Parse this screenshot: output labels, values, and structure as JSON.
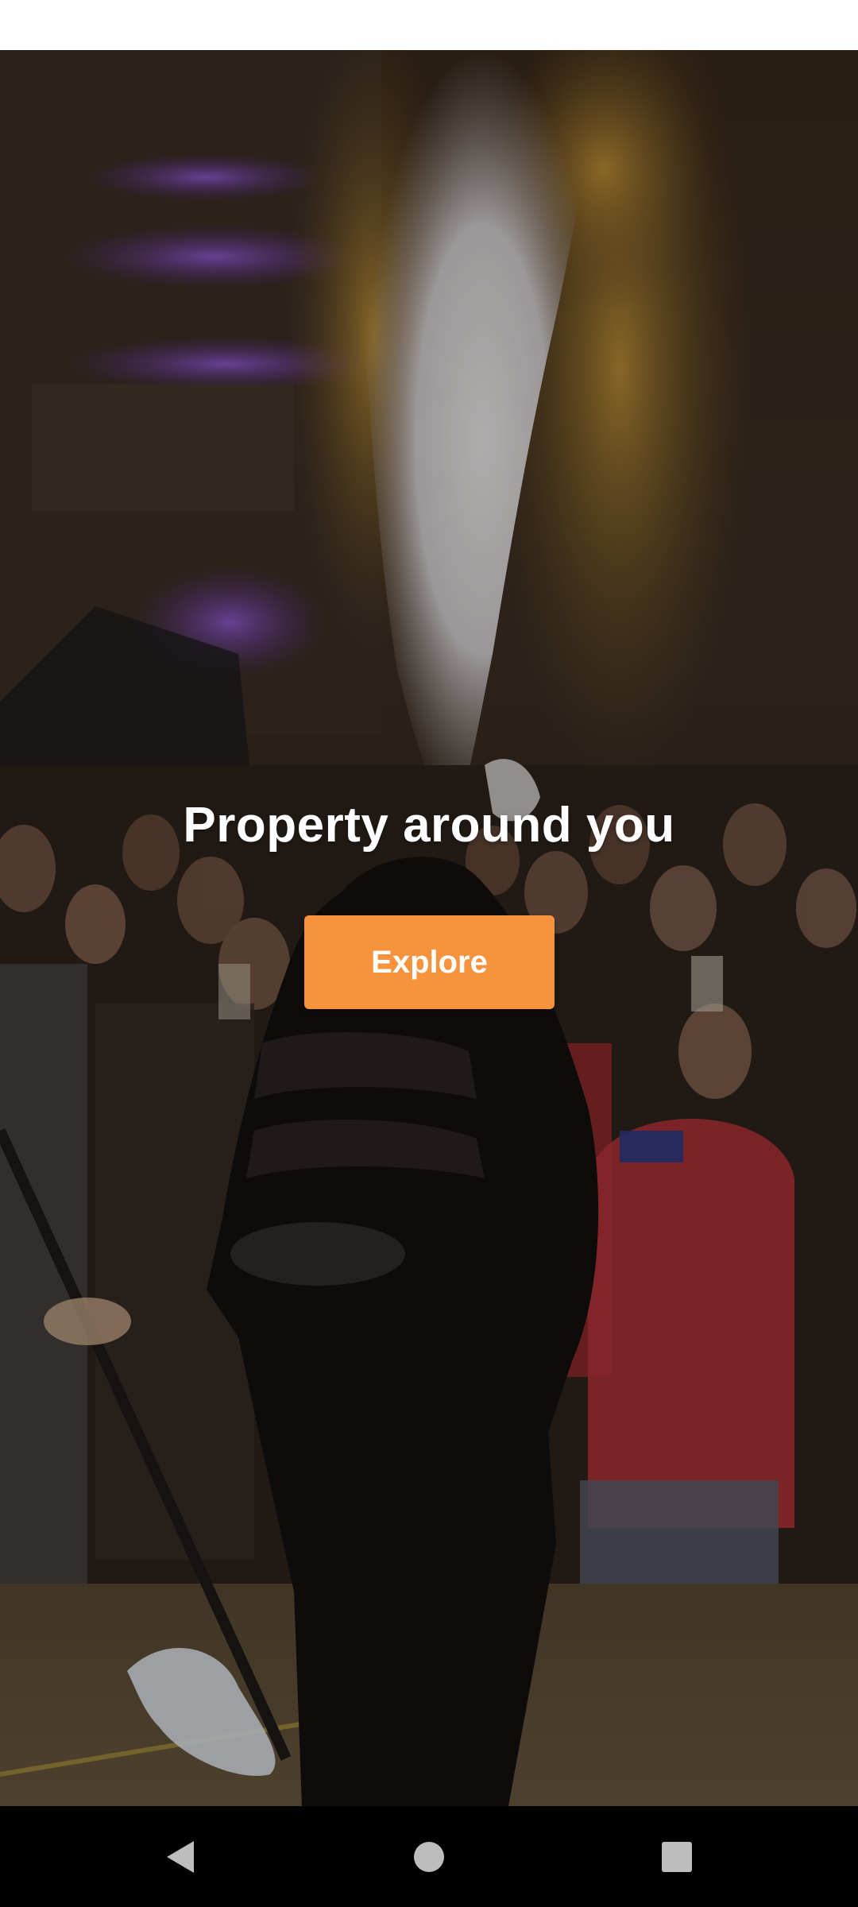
{
  "hero": {
    "headline": "Property around you",
    "explore_label": "Explore",
    "background_image": "fire-performer-crowd-photo"
  },
  "colors": {
    "accent": "#f7923d",
    "status_bar": "#ffffff",
    "nav_bar": "#000000",
    "headline_text": "#ffffff"
  },
  "nav_bar": {
    "icons": [
      "back-icon",
      "home-icon",
      "recents-icon"
    ]
  }
}
